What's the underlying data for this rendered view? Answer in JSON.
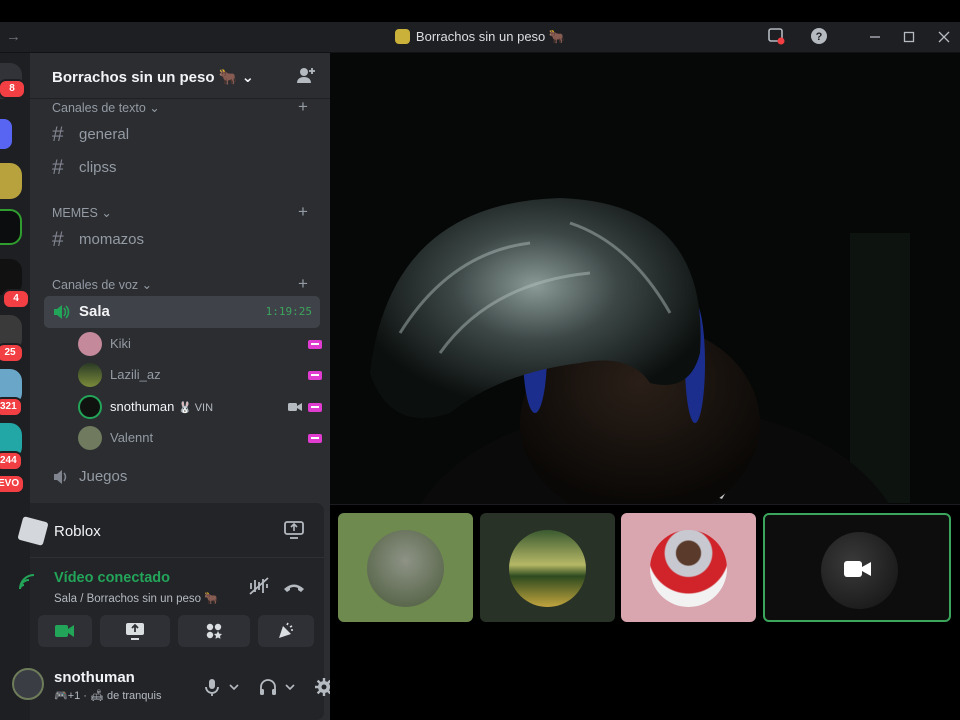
{
  "window": {
    "title": "Borrachos sin un peso 🐂",
    "icons": [
      "inbox-icon",
      "help-icon",
      "minimize-icon",
      "maximize-icon",
      "close-icon"
    ]
  },
  "servers": {
    "badges": [
      "8",
      "4",
      "25",
      "321",
      "244",
      "EVO"
    ]
  },
  "server": {
    "name": "Borrachos sin un peso 🐂",
    "categories": [
      {
        "label": "Canales de texto"
      },
      {
        "label": "MEMES"
      },
      {
        "label": "Canales de voz"
      }
    ],
    "text_channels": [
      "general",
      "clipss"
    ],
    "meme_channels": [
      "momazos"
    ],
    "voice_channel": {
      "name": "Sala",
      "timer": "1:19:25"
    },
    "voice_users": [
      {
        "name": "Kiki"
      },
      {
        "name": "Lazili_az"
      },
      {
        "name": "snothuman",
        "tag": "🐰 VIN"
      },
      {
        "name": "Valennt"
      }
    ],
    "other_voice_channel": "Juegos"
  },
  "activity": {
    "name": "Roblox"
  },
  "voice": {
    "status": "Vídeo conectado",
    "channel": "Sala / Borrachos sin un peso 🐂"
  },
  "user": {
    "name": "snothuman",
    "status_prefix": "🎮+1 · 🛋",
    "status_text": "de tranquis"
  },
  "colors": {
    "accent_green": "#23a559",
    "stream_pink": "#e03ccf",
    "danger": "#f23f43"
  }
}
